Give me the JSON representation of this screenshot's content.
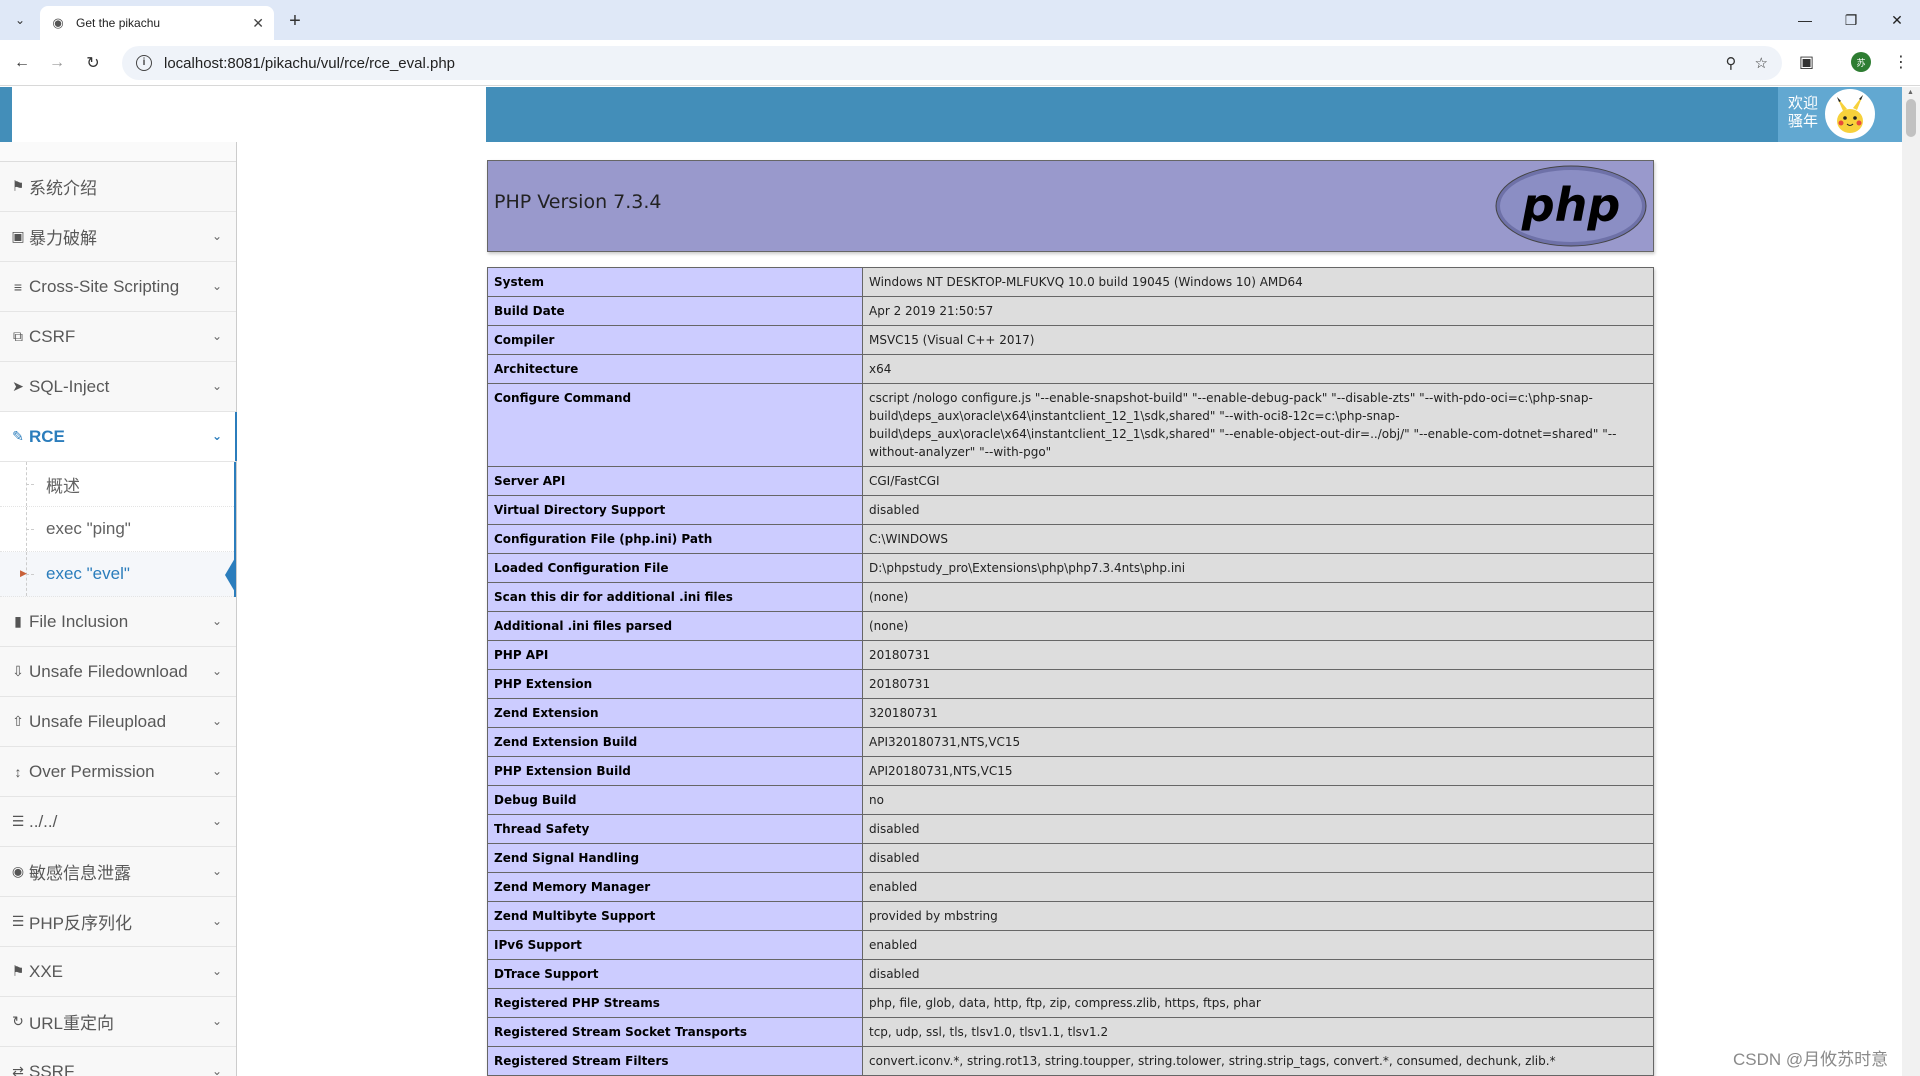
{
  "browser": {
    "tab_title": "Get the pikachu",
    "url": "localhost:8081/pikachu/vul/rce/rce_eval.php",
    "profile_initial": "苏"
  },
  "header": {
    "welcome_line1": "欢迎",
    "welcome_line2": "骚年"
  },
  "sidebar": {
    "items": [
      {
        "label": "系统介绍",
        "icon": "tag-icon",
        "expandable": false
      },
      {
        "label": "暴力破解",
        "icon": "lock-icon",
        "expandable": true
      },
      {
        "label": "Cross-Site Scripting",
        "icon": "sliders-icon",
        "expandable": true
      },
      {
        "label": "CSRF",
        "icon": "share-icon",
        "expandable": true
      },
      {
        "label": "SQL-Inject",
        "icon": "plane-icon",
        "expandable": true
      },
      {
        "label": "RCE",
        "icon": "pencil-icon",
        "expandable": true
      },
      {
        "label": "File Inclusion",
        "icon": "file-icon",
        "expandable": true
      },
      {
        "label": "Unsafe Filedownload",
        "icon": "download-icon",
        "expandable": true
      },
      {
        "label": "Unsafe Fileupload",
        "icon": "upload-icon",
        "expandable": true
      },
      {
        "label": "Over Permission",
        "icon": "text-height-icon",
        "expandable": true
      },
      {
        "label": "../../",
        "icon": "list-icon",
        "expandable": true
      },
      {
        "label": "敏感信息泄露",
        "icon": "camera-icon",
        "expandable": true
      },
      {
        "label": "PHP反序列化",
        "icon": "list-icon",
        "expandable": true
      },
      {
        "label": "XXE",
        "icon": "flag-icon",
        "expandable": true
      },
      {
        "label": "URL重定向",
        "icon": "refresh-icon",
        "expandable": true
      },
      {
        "label": "SSRF",
        "icon": "exchange-icon",
        "expandable": true
      }
    ],
    "rce_submenu": [
      "概述",
      "exec \"ping\"",
      "exec \"evel\""
    ]
  },
  "phpinfo": {
    "version": "PHP Version 7.3.4",
    "logo_text": "php",
    "rows": [
      {
        "k": "System",
        "v": "Windows NT DESKTOP-MLFUKVQ 10.0 build 19045 (Windows 10) AMD64"
      },
      {
        "k": "Build Date",
        "v": "Apr 2 2019 21:50:57"
      },
      {
        "k": "Compiler",
        "v": "MSVC15 (Visual C++ 2017)"
      },
      {
        "k": "Architecture",
        "v": "x64"
      },
      {
        "k": "Configure Command",
        "v": "cscript /nologo configure.js \"--enable-snapshot-build\" \"--enable-debug-pack\" \"--disable-zts\" \"--with-pdo-oci=c:\\php-snap-build\\deps_aux\\oracle\\x64\\instantclient_12_1\\sdk,shared\" \"--with-oci8-12c=c:\\php-snap-build\\deps_aux\\oracle\\x64\\instantclient_12_1\\sdk,shared\" \"--enable-object-out-dir=../obj/\" \"--enable-com-dotnet=shared\" \"--without-analyzer\" \"--with-pgo\""
      },
      {
        "k": "Server API",
        "v": "CGI/FastCGI"
      },
      {
        "k": "Virtual Directory Support",
        "v": "disabled"
      },
      {
        "k": "Configuration File (php.ini) Path",
        "v": "C:\\WINDOWS"
      },
      {
        "k": "Loaded Configuration File",
        "v": "D:\\phpstudy_pro\\Extensions\\php\\php7.3.4nts\\php.ini"
      },
      {
        "k": "Scan this dir for additional .ini files",
        "v": "(none)"
      },
      {
        "k": "Additional .ini files parsed",
        "v": "(none)"
      },
      {
        "k": "PHP API",
        "v": "20180731"
      },
      {
        "k": "PHP Extension",
        "v": "20180731"
      },
      {
        "k": "Zend Extension",
        "v": "320180731"
      },
      {
        "k": "Zend Extension Build",
        "v": "API320180731,NTS,VC15"
      },
      {
        "k": "PHP Extension Build",
        "v": "API20180731,NTS,VC15"
      },
      {
        "k": "Debug Build",
        "v": "no"
      },
      {
        "k": "Thread Safety",
        "v": "disabled"
      },
      {
        "k": "Zend Signal Handling",
        "v": "disabled"
      },
      {
        "k": "Zend Memory Manager",
        "v": "enabled"
      },
      {
        "k": "Zend Multibyte Support",
        "v": "provided by mbstring"
      },
      {
        "k": "IPv6 Support",
        "v": "enabled"
      },
      {
        "k": "DTrace Support",
        "v": "disabled"
      },
      {
        "k": "Registered PHP Streams",
        "v": "php, file, glob, data, http, ftp, zip, compress.zlib, https, ftps, phar"
      },
      {
        "k": "Registered Stream Socket Transports",
        "v": "tcp, udp, ssl, tls, tlsv1.0, tlsv1.1, tlsv1.2"
      },
      {
        "k": "Registered Stream Filters",
        "v": "convert.iconv.*, string.rot13, string.toupper, string.tolower, string.strip_tags, convert.*, consumed, dechunk, zlib.*"
      }
    ]
  },
  "watermark": "CSDN @月攸苏时意"
}
